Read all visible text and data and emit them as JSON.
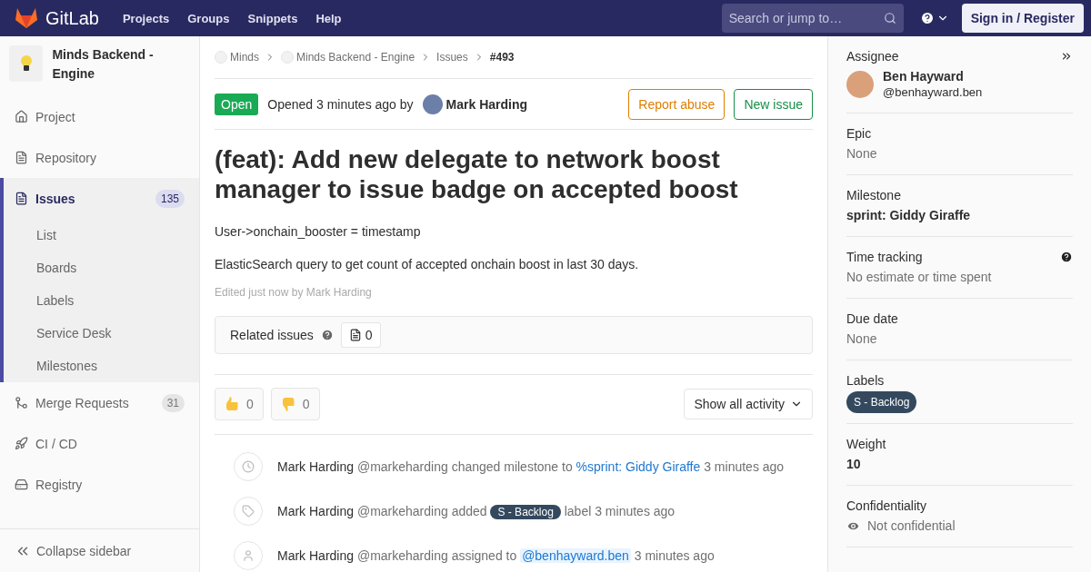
{
  "header": {
    "logo": "GitLab",
    "nav": [
      "Projects",
      "Groups",
      "Snippets",
      "Help"
    ],
    "search": {
      "placeholder": "Search or jump to…"
    },
    "sign_in": "Sign in / Register"
  },
  "sidebar": {
    "project": "Minds Backend - Engine",
    "items": [
      {
        "kind": "project",
        "label": "Project",
        "selected": false
      },
      {
        "kind": "repository",
        "label": "Repository",
        "selected": false
      },
      {
        "kind": "issues",
        "label": "Issues",
        "count": "135",
        "selected": true,
        "children": [
          {
            "label": "List"
          },
          {
            "label": "Boards"
          },
          {
            "label": "Labels"
          },
          {
            "label": "Service Desk"
          },
          {
            "label": "Milestones"
          }
        ]
      },
      {
        "kind": "merge",
        "label": "Merge Requests",
        "count": "31",
        "selected": false
      },
      {
        "kind": "cicd",
        "label": "CI / CD",
        "selected": false
      },
      {
        "kind": "registry",
        "label": "Registry",
        "selected": false
      }
    ],
    "collapse": "Collapse sidebar"
  },
  "breadcrumbs": [
    {
      "label": "Minds",
      "avatar": true,
      "current": false
    },
    {
      "label": "Minds Backend - Engine",
      "avatar": true,
      "current": false
    },
    {
      "label": "Issues",
      "avatar": false,
      "current": false
    },
    {
      "label": "#493",
      "avatar": false,
      "current": true
    }
  ],
  "issue": {
    "status": "Open",
    "opened": "Opened 3 minutes ago by",
    "author": "Mark Harding",
    "buttons": [
      {
        "kind": "warning",
        "label": "Report abuse"
      },
      {
        "kind": "success",
        "label": "New issue"
      }
    ],
    "title": "(feat): Add new delegate to network boost manager to issue badge on accepted boost",
    "description": [
      "User->onchain_booster = timestamp",
      "ElasticSearch query to get count of accepted onchain boost in last 30 days."
    ],
    "edited": "Edited just now by Mark Harding"
  },
  "related": {
    "label": "Related issues",
    "count": "0"
  },
  "awards": [
    {
      "kind": "thumbsup",
      "count": "0"
    },
    {
      "kind": "thumbsdown",
      "count": "0"
    }
  ],
  "activity_filter": "Show all activity",
  "timeline": [
    {
      "kind": "clock",
      "author": "Mark Harding",
      "handle": "@markeharding",
      "parts": [
        {
          "kind": "text",
          "text": "changed milestone to"
        },
        {
          "kind": "link",
          "text": "%sprint: Giddy Giraffe"
        }
      ],
      "time": "3 minutes ago"
    },
    {
      "kind": "tag",
      "author": "Mark Harding",
      "handle": "@markeharding",
      "parts": [
        {
          "kind": "text",
          "text": "added"
        },
        {
          "kind": "label",
          "text": "S - Backlog"
        },
        {
          "kind": "text",
          "text": "label"
        }
      ],
      "time": "3 minutes ago"
    },
    {
      "kind": "person",
      "author": "Mark Harding",
      "handle": "@markeharding",
      "parts": [
        {
          "kind": "text",
          "text": "assigned to"
        },
        {
          "kind": "mention",
          "text": "@benhayward.ben"
        }
      ],
      "time": "3 minutes ago"
    }
  ],
  "right": {
    "assignee": {
      "title": "Assignee",
      "name": "Ben Hayward",
      "handle": "@benhayward.ben"
    },
    "sections": [
      {
        "kind": "muted",
        "title": "Epic",
        "value": "None",
        "help": false
      },
      {
        "kind": "bold",
        "title": "Milestone",
        "value": "sprint: Giddy Giraffe",
        "help": false
      },
      {
        "kind": "muted",
        "title": "Time tracking",
        "value": "No estimate or time spent",
        "help": true
      },
      {
        "kind": "muted",
        "title": "Due date",
        "value": "None",
        "help": false
      },
      {
        "kind": "label",
        "title": "Labels",
        "value": "S - Backlog",
        "help": false
      },
      {
        "kind": "bold",
        "title": "Weight",
        "value": "10",
        "help": false
      },
      {
        "kind": "eye",
        "title": "Confidentiality",
        "value": "Not confidential",
        "help": false
      }
    ]
  }
}
